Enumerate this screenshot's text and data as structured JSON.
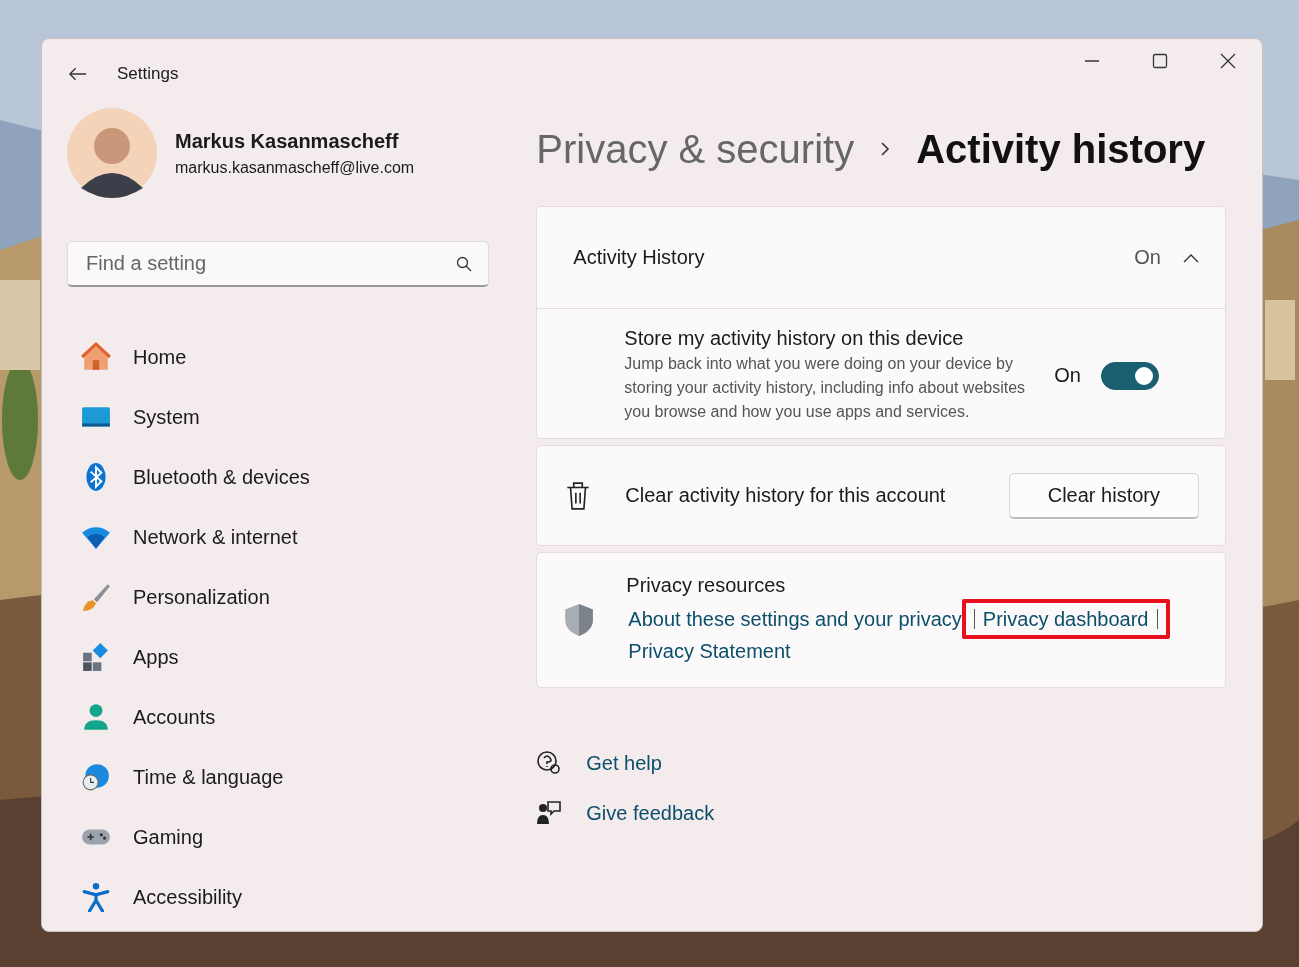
{
  "window": {
    "title": "Settings"
  },
  "user": {
    "name": "Markus Kasanmascheff",
    "email": "markus.kasanmascheff@live.com"
  },
  "search": {
    "placeholder": "Find a setting"
  },
  "nav": [
    {
      "label": "Home"
    },
    {
      "label": "System"
    },
    {
      "label": "Bluetooth & devices"
    },
    {
      "label": "Network & internet"
    },
    {
      "label": "Personalization"
    },
    {
      "label": "Apps"
    },
    {
      "label": "Accounts"
    },
    {
      "label": "Time & language"
    },
    {
      "label": "Gaming"
    },
    {
      "label": "Accessibility"
    }
  ],
  "breadcrumb": {
    "parent": "Privacy & security",
    "current": "Activity history"
  },
  "activity_card": {
    "title": "Activity History",
    "status": "On",
    "expanded": true,
    "setting": {
      "title": "Store my activity history on this device",
      "description": "Jump back into what you were doing on your device by storing your activity history, including info about websites you browse and how you use apps and services.",
      "state_label": "On",
      "on": true
    }
  },
  "clear_card": {
    "label": "Clear activity history for this account",
    "button": "Clear history"
  },
  "resources": {
    "title": "Privacy resources",
    "links": [
      {
        "text": "About these settings and your privacy",
        "highlighted": false
      },
      {
        "text": "Privacy dashboard",
        "highlighted": true
      },
      {
        "text": "Privacy Statement",
        "highlighted": false
      }
    ]
  },
  "help_links": [
    {
      "text": "Get help"
    },
    {
      "text": "Give feedback"
    }
  ]
}
